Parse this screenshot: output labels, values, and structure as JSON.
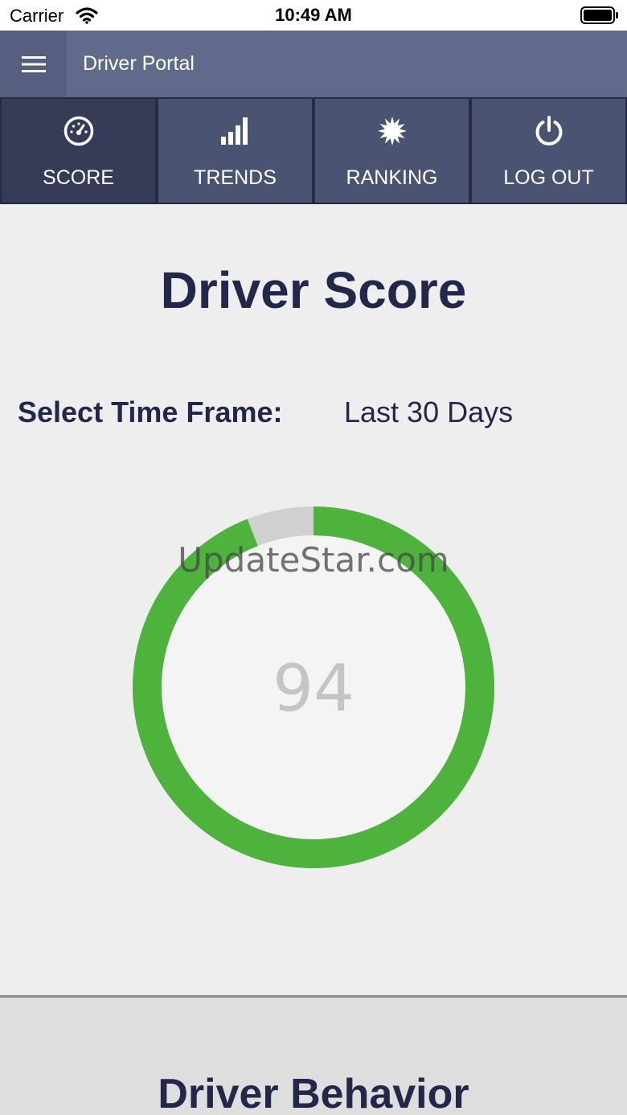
{
  "status_bar": {
    "carrier": "Carrier",
    "time": "10:49 AM"
  },
  "app_bar": {
    "title": "Driver Portal",
    "menu_icon": "hamburger-menu-icon"
  },
  "tabs": [
    {
      "label": "SCORE",
      "icon": "speedometer-icon",
      "active": true
    },
    {
      "label": "TRENDS",
      "icon": "signal-bars-icon",
      "active": false
    },
    {
      "label": "RANKING",
      "icon": "badge-star-icon",
      "active": false
    },
    {
      "label": "LOG OUT",
      "icon": "power-icon",
      "active": false
    }
  ],
  "main": {
    "title": "Driver Score",
    "time_frame_label": "Select Time Frame:",
    "time_frame_value": "Last 30 Days",
    "score": {
      "value": "94",
      "fraction": 0.94,
      "fill_color": "#4db33d",
      "track_color": "#d0d0d0"
    },
    "watermark": "UpdateStar.com"
  },
  "behavior": {
    "title": "Driver Behavior"
  },
  "colors": {
    "app_bar": "#626a8c",
    "tab": "#4b5372",
    "tab_active": "#363c58",
    "heading_text": "#23284a"
  }
}
